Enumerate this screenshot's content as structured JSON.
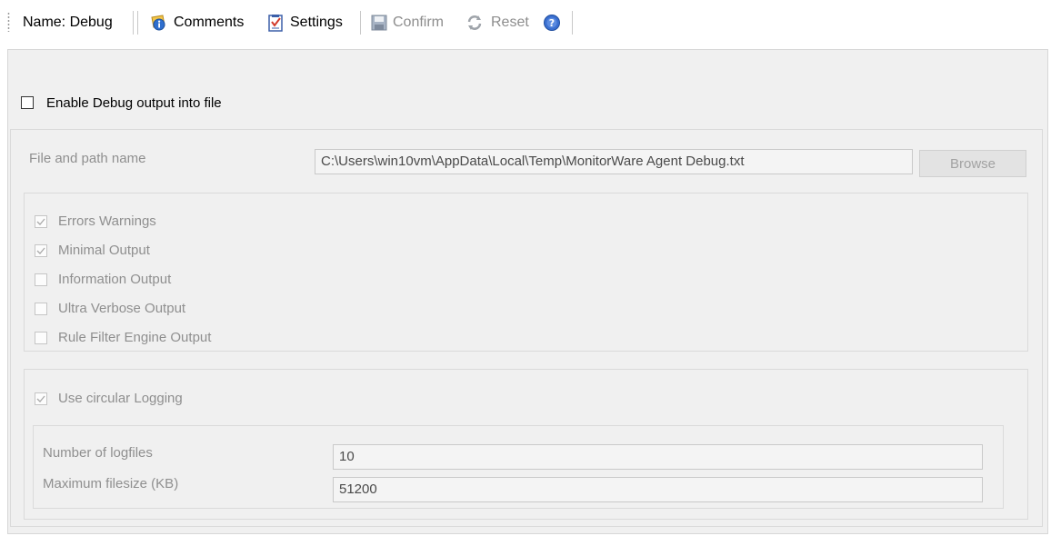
{
  "toolbar": {
    "name_label": "Name: Debug",
    "comments_label": "Comments",
    "settings_label": "Settings",
    "confirm_label": "Confirm",
    "reset_label": "Reset"
  },
  "enable_debug": {
    "label": "Enable Debug output into file",
    "checked": false
  },
  "file": {
    "label": "File and path name",
    "value": "C:\\Users\\win10vm\\AppData\\Local\\Temp\\MonitorWare Agent Debug.txt",
    "browse_label": "Browse"
  },
  "levels": [
    {
      "label": "Errors  Warnings",
      "checked": true
    },
    {
      "label": "Minimal Output",
      "checked": true
    },
    {
      "label": "Information Output",
      "checked": false
    },
    {
      "label": "Ultra Verbose Output",
      "checked": false
    },
    {
      "label": "Rule  Filter Engine Output",
      "checked": false
    }
  ],
  "circular": {
    "label": "Use circular Logging",
    "checked": true,
    "logfiles_label": "Number of logfiles",
    "logfiles_value": "10",
    "filesize_label": "Maximum filesize (KB)",
    "filesize_value": "51200"
  },
  "icons": {
    "comments": "comments-info-icon",
    "settings": "settings-checklist-icon",
    "confirm": "save-disk-icon",
    "reset": "reset-arrows-icon",
    "help": "help-icon"
  },
  "colors": {
    "panel_background": "#f0f0f0",
    "disabled_text": "#8f8f8f",
    "help_blue": "#3a6fd0"
  }
}
